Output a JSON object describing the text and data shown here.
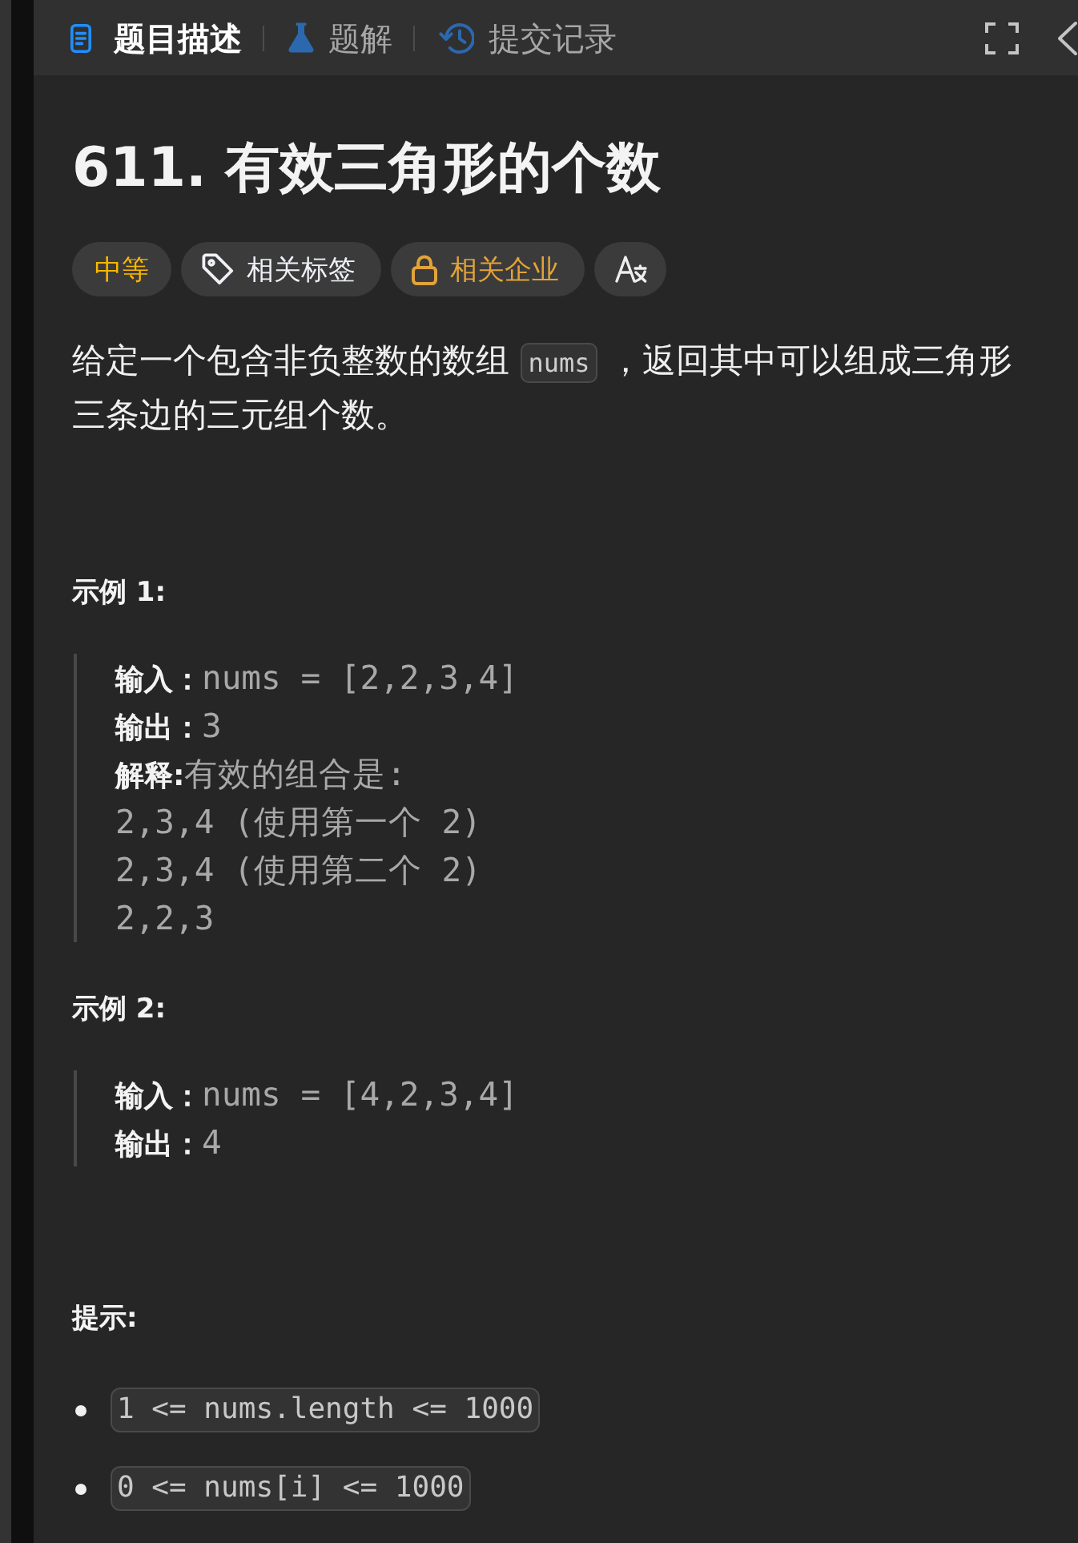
{
  "tabs": [
    {
      "kind": "description",
      "label": "题目描述",
      "selected": true
    },
    {
      "kind": "solutions",
      "label": "题解",
      "selected": false
    },
    {
      "kind": "submissions",
      "label": "提交记录",
      "selected": false
    }
  ],
  "problem": {
    "title": "611. 有效三角形的个数",
    "tags": [
      {
        "kind": "difficulty",
        "label": "中等",
        "color": "#ffb800"
      },
      {
        "kind": "topics",
        "label": "相关标签",
        "color": "#eff1f6"
      },
      {
        "kind": "companies",
        "label": "相关企业",
        "color": "#e2a33a"
      },
      {
        "kind": "translate"
      }
    ],
    "description": [
      {
        "kind": "text",
        "text": "给定一个包含非负整数的数组 "
      },
      {
        "kind": "code",
        "text": "nums"
      },
      {
        "kind": "text",
        "text": " ，返回其中可以组成三角形三条边的三元组个数。"
      }
    ],
    "examples": [
      {
        "title": "示例 1:",
        "lines": [
          "**输入：**nums = [2,2,3,4]",
          "**输出：**3",
          "**解释:**有效的组合是: ",
          "2,3,4 (使用第一个 2)",
          "2,3,4 (使用第二个 2)",
          "2,2,3"
        ]
      },
      {
        "title": "示例 2:",
        "lines": [
          "**输入：**nums = [4,2,3,4]",
          "**输出：**4"
        ]
      }
    ],
    "constraints": {
      "title": "提示:",
      "items": [
        "1 <= nums.length <= 1000",
        "0 <= nums[i] <= 1000"
      ]
    }
  }
}
